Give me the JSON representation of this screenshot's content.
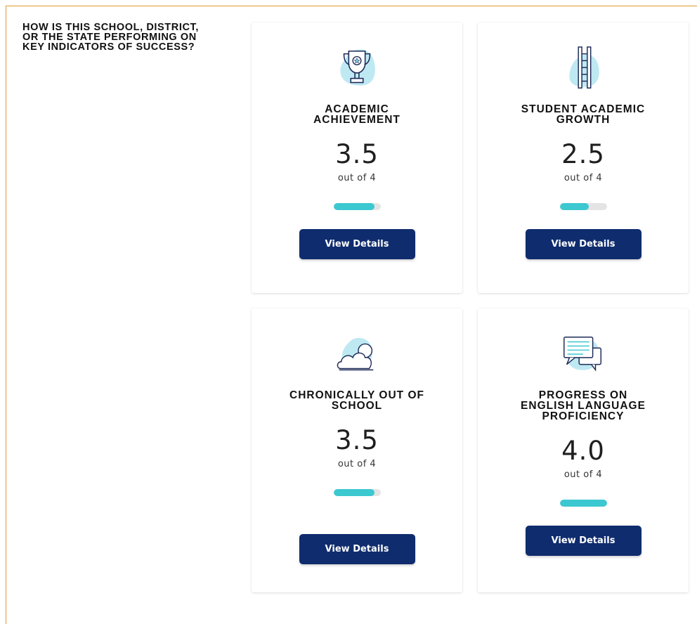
{
  "heading": "HOW IS THIS SCHOOL, DISTRICT, OR THE STATE PERFORMING ON KEY INDICATORS OF SUCCESS?",
  "colors": {
    "accent_border": "#e09a2f",
    "bar_fill": "#3cc8d0",
    "bar_track": "#e4e4e4",
    "button": "#0f2c6e",
    "icon_blob": "#bfe9f2",
    "icon_stroke": "#1d2a57"
  },
  "cards": [
    {
      "icon": "trophy-icon",
      "title": "ACADEMIC ACHIEVEMENT",
      "score": "3.5",
      "out_of": "out of 4",
      "progress": 0.875,
      "button_label": "View Details"
    },
    {
      "icon": "ladder-icon",
      "title": "STUDENT ACADEMIC GROWTH",
      "score": "2.5",
      "out_of": "out of 4",
      "progress": 0.625,
      "button_label": "View Details"
    },
    {
      "icon": "cloud-sun-icon",
      "title": "CHRONICALLY OUT OF SCHOOL",
      "score": "3.5",
      "out_of": "out of 4",
      "progress": 0.875,
      "button_label": "View Details"
    },
    {
      "icon": "chat-bubbles-icon",
      "title": "PROGRESS ON ENGLISH LANGUAGE PROFICIENCY",
      "score": "4.0",
      "out_of": "out of 4",
      "progress": 1.0,
      "button_label": "View Details"
    }
  ]
}
